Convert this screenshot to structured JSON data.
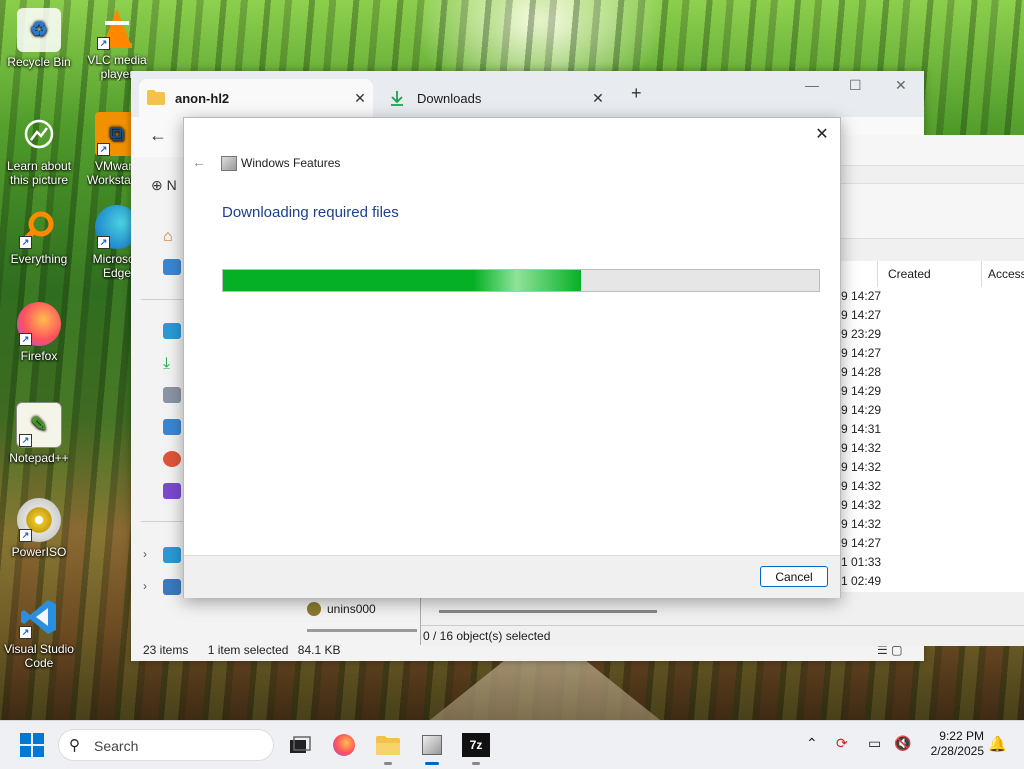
{
  "desktop": {
    "icons": [
      {
        "label": "Recycle Bin"
      },
      {
        "label": "VLC media player"
      },
      {
        "label": "Learn about this picture"
      },
      {
        "label": "VMware Workstation"
      },
      {
        "label": "Everything"
      },
      {
        "label": "Microsoft Edge"
      },
      {
        "label": "Firefox"
      },
      {
        "label": "Notepad++"
      },
      {
        "label": "PowerISO"
      },
      {
        "label": "Visual Studio Code"
      }
    ]
  },
  "explorer": {
    "tabs": [
      {
        "label": "anon-hl2",
        "close": "✕"
      },
      {
        "label": "Downloads",
        "close": "✕"
      }
    ],
    "new_tab": "+",
    "new_button": "N",
    "file_item": "unins000",
    "status": {
      "items_count": "23 items",
      "selected": "1 item selected",
      "size": "84.1 KB"
    }
  },
  "zip_panel": {
    "columns": [
      "Created",
      "Access"
    ],
    "times": [
      "9 14:27",
      "9 14:27",
      "9 23:29",
      "9 14:27",
      "9 14:28",
      "9 14:29",
      "9 14:29",
      "9 14:31",
      "9 14:32",
      "9 14:32",
      "9 14:32",
      "9 14:32",
      "9 14:32",
      "9 14:27",
      "1 01:33",
      "1 02:49"
    ],
    "status": "0 / 16 object(s) selected"
  },
  "dialog": {
    "app_title": "Windows Features",
    "heading": "Downloading required files",
    "progress_fraction": 0.6,
    "cancel_label": "Cancel",
    "accent_color": "#06b025"
  },
  "taskbar": {
    "search_placeholder": "Search",
    "time": "9:22 PM",
    "date": "2/28/2025"
  }
}
